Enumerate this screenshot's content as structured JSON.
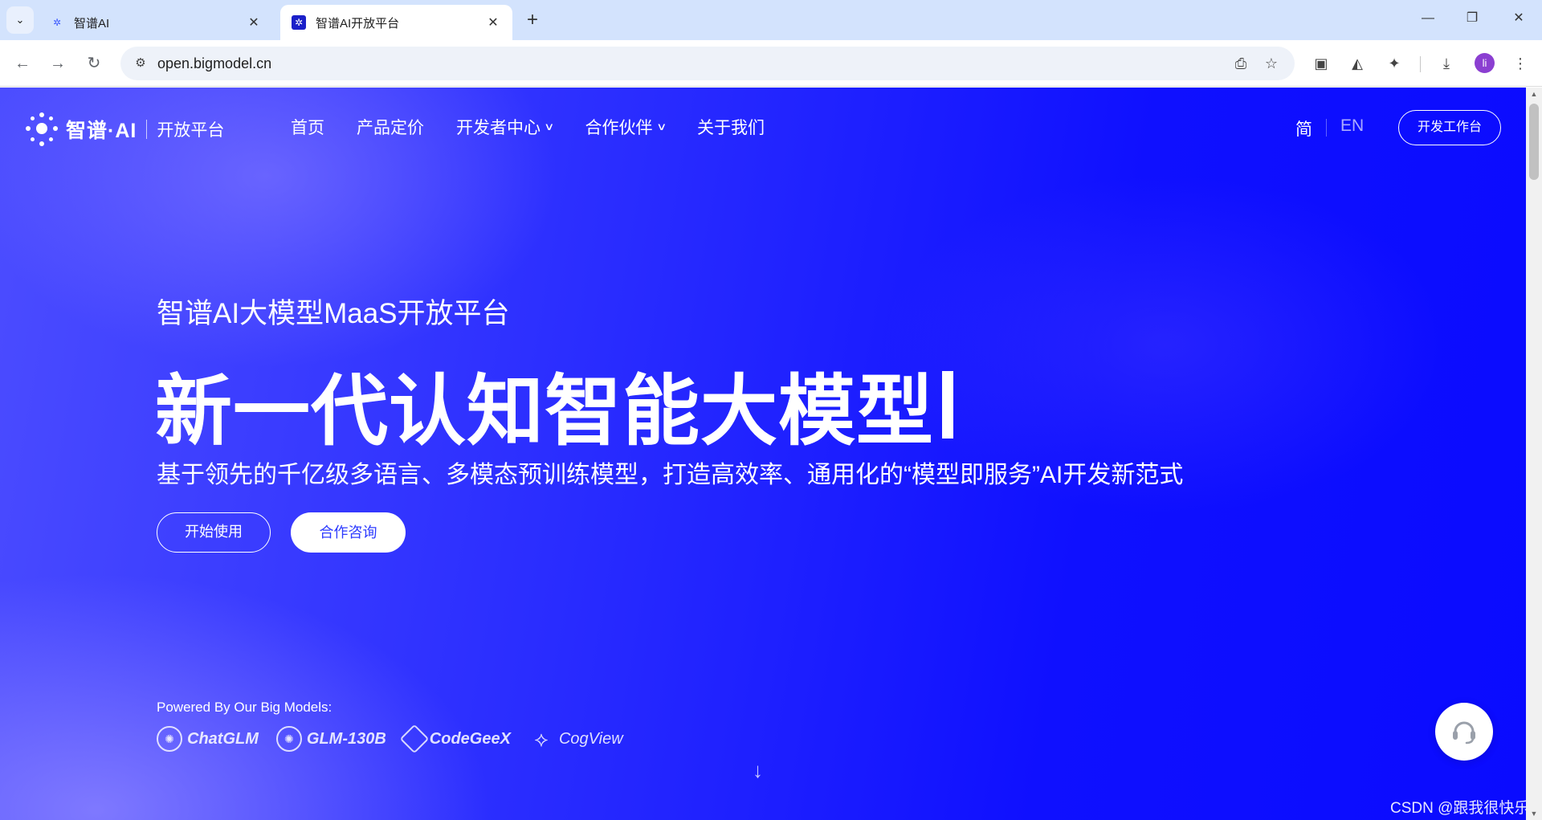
{
  "browser": {
    "tabs": [
      {
        "title": "智谱AI",
        "active": false
      },
      {
        "title": "智谱AI开放平台",
        "active": true
      }
    ],
    "url": "open.bigmodel.cn",
    "profile_initial": "li"
  },
  "site": {
    "logo_name": "智谱·AI",
    "logo_sub": "开放平台",
    "nav": [
      "首页",
      "产品定价",
      "开发者中心",
      "合作伙伴",
      "关于我们"
    ],
    "lang_zh": "简",
    "lang_en": "EN",
    "console_button": "开发工作台"
  },
  "hero": {
    "subtitle": "智谱AI大模型MaaS开放平台",
    "title": "新一代认知智能大模型",
    "description": "基于领先的千亿级多语言、多模态预训练模型，打造高效率、通用化的“模型即服务”AI开发新范式",
    "start_button": "开始使用",
    "consult_button": "合作咨询"
  },
  "models": {
    "caption": "Powered By Our Big Models:",
    "items": [
      "ChatGLM",
      "GLM-130B",
      "CodeGeeX",
      "CogView"
    ]
  },
  "watermark": "CSDN @跟我很快乐",
  "colors": {
    "hero_blue": "#1414ff",
    "chrome_tabbar": "#d3e3fd",
    "consult_text": "#2d3bff"
  }
}
